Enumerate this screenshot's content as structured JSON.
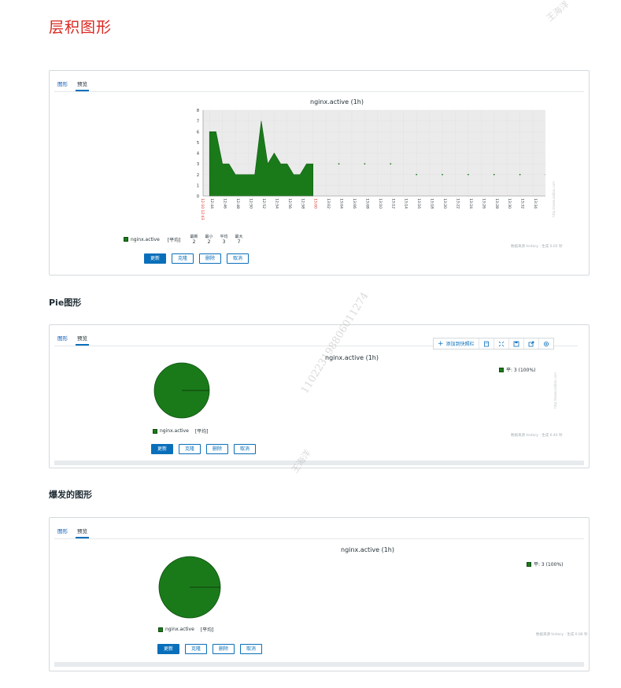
{
  "doc_title": "层积图形",
  "watermarks": {
    "name": "王海洋",
    "number": "110223198806011274"
  },
  "sections": {
    "pie": "Pie图形",
    "exploded": "爆发的图形"
  },
  "tabs": {
    "graph": "图形",
    "preview": "预览"
  },
  "buttons": {
    "update": "更新",
    "clone": "克隆",
    "delete": "删除",
    "cancel": "取消"
  },
  "stacked": {
    "title": "nginx.active (1h)",
    "legend_item": "nginx.active",
    "legend_func": "[平均]",
    "stat_headers": [
      "最新",
      "最小",
      "平均",
      "最大"
    ],
    "stat_values": [
      "2",
      "2",
      "3",
      "7"
    ],
    "data_source": "数据来源 history · 生成 0.02 秒",
    "start_label": "12-10 12:43",
    "end_label": "12-10 13:43",
    "mid_label": "13:00",
    "url": "http://www.zabbix.com"
  },
  "pie": {
    "title": "nginx.active (1h)",
    "legend_item": "nginx.active",
    "legend_func": "[平均]",
    "series_label": "平: 3 (100%)",
    "data_source": "数据来源 history · 生成 0.40 秒",
    "url": "http://www.zabbix.com",
    "toolbar_add": "添加到快照栏"
  },
  "exploded": {
    "title": "nginx.active (1h)",
    "legend_item": "nginx.active",
    "legend_func": "[平均]",
    "series_label": "平: 3 (100%)",
    "data_source": "数据来源 history · 生成 0.08 秒"
  },
  "colors": {
    "series": "#1a7a1a",
    "plot_bg": "#ebebeb",
    "accent": "#0a6fba",
    "title": "#d9271f"
  },
  "chart_data": [
    {
      "type": "area",
      "title": "nginx.active (1h)",
      "x": [
        "12:44",
        "12:45",
        "12:46",
        "12:47",
        "12:48",
        "12:49",
        "12:50",
        "12:51",
        "12:52",
        "12:53",
        "12:54",
        "12:55",
        "12:56",
        "12:57",
        "12:58",
        "12:59",
        "13:00",
        "13:04",
        "13:08",
        "13:12",
        "13:16",
        "13:20",
        "13:24",
        "13:28",
        "13:32",
        "13:36",
        "13:40"
      ],
      "series": [
        {
          "name": "nginx.active",
          "values": [
            6,
            6,
            3,
            3,
            2,
            2,
            2,
            2,
            7,
            3,
            4,
            3,
            3,
            2,
            2,
            3,
            3,
            3,
            3,
            3,
            2,
            2,
            2,
            2,
            2,
            2,
            2
          ]
        }
      ],
      "x_ticks": [
        "12:44",
        "12:46",
        "12:48",
        "12:50",
        "12:52",
        "12:54",
        "12:56",
        "12:58",
        "13:00",
        "13:02",
        "13:04",
        "13:06",
        "13:08",
        "13:10",
        "13:12",
        "13:14",
        "13:16",
        "13:18",
        "13:20",
        "13:22",
        "13:24",
        "13:26",
        "13:28",
        "13:30",
        "13:32",
        "13:34",
        "13:36",
        "13:38",
        "13:40",
        "13:42"
      ],
      "y_ticks": [
        "0",
        "1",
        "2",
        "3",
        "4",
        "5",
        "6",
        "7",
        "8"
      ],
      "ylim": [
        0,
        8
      ],
      "grid": true
    },
    {
      "type": "pie",
      "title": "nginx.active (1h)",
      "categories": [
        "nginx.active"
      ],
      "values": [
        100
      ]
    },
    {
      "type": "pie",
      "title": "nginx.active (1h)",
      "categories": [
        "nginx.active"
      ],
      "values": [
        100
      ]
    }
  ]
}
